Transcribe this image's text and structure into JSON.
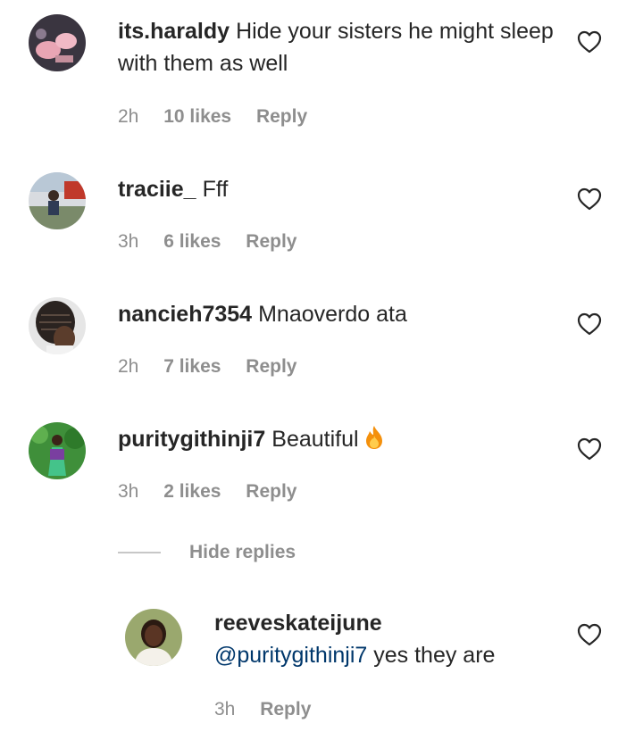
{
  "comments": [
    {
      "username": "its.haraldy",
      "text": "Hide your sisters he might sleep with them as well",
      "time": "2h",
      "likes": "10 likes",
      "reply": "Reply"
    },
    {
      "username": "traciie_",
      "text": "Fff",
      "time": "3h",
      "likes": "6 likes",
      "reply": "Reply"
    },
    {
      "username": "nancieh7354",
      "text": "Mnaoverdo ata",
      "time": "2h",
      "likes": "7 likes",
      "reply": "Reply"
    },
    {
      "username": "puritygithinji7",
      "text": "Beautiful",
      "emoji": "fire-emoji",
      "time": "3h",
      "likes": "2 likes",
      "reply": "Reply"
    }
  ],
  "hide_replies": "Hide replies",
  "reply_comment": {
    "username": "reeveskateijune",
    "mention": "@puritygithinji7",
    "text": "yes they are",
    "time": "3h",
    "reply": "Reply"
  },
  "colors": {
    "text": "#262626",
    "meta": "#8e8e8e",
    "mention": "#00376b"
  },
  "icons": {
    "like": "heart-outline-icon"
  }
}
